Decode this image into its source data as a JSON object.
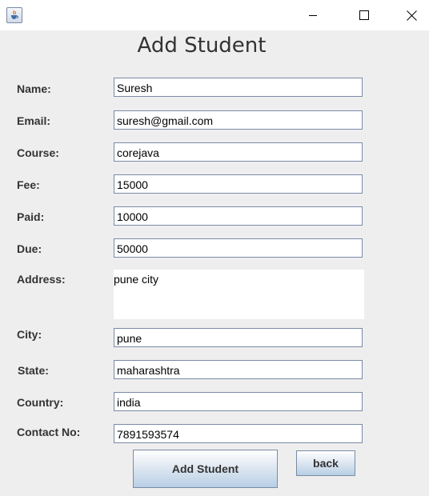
{
  "window": {
    "icon": "java-cup-icon",
    "controls": [
      "minimize-icon",
      "maximize-icon",
      "close-icon"
    ]
  },
  "form": {
    "title": "Add Student",
    "fields": {
      "name": {
        "label": "Name:",
        "value": "Suresh"
      },
      "email": {
        "label": "Email:",
        "value": "suresh@gmail.com"
      },
      "course": {
        "label": "Course:",
        "value": "corejava"
      },
      "fee": {
        "label": "Fee:",
        "value": "15000"
      },
      "paid": {
        "label": "Paid:",
        "value": "10000"
      },
      "due": {
        "label": "Due:",
        "value": "50000"
      },
      "address": {
        "label": "Address:",
        "value": "pune city"
      },
      "city": {
        "label": "City:",
        "value": "pune"
      },
      "state": {
        "label": "State:",
        "value": "maharashtra"
      },
      "country": {
        "label": "Country:",
        "value": "india"
      },
      "contact": {
        "label": "Contact No:",
        "value": "7891593574"
      }
    }
  },
  "buttons": {
    "add_student": "Add Student",
    "back": "back"
  },
  "colors": {
    "background": "#eeeeee",
    "titlebar": "#ffffff",
    "field_border": "#7a8aa6",
    "text": "#333333"
  }
}
